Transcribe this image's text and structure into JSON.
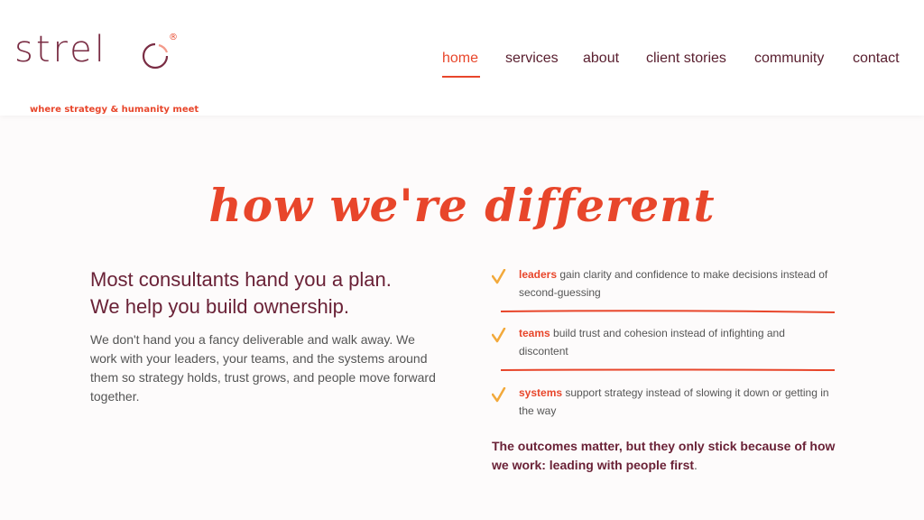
{
  "brand": {
    "logo_text": "strel",
    "registered": "®",
    "tagline": "where strategy & humanity meet"
  },
  "nav": {
    "items": [
      {
        "label": "home",
        "active": true
      },
      {
        "label": "services"
      },
      {
        "label": "about"
      },
      {
        "label": "client stories"
      },
      {
        "label": "community"
      },
      {
        "label": "contact"
      }
    ]
  },
  "section": {
    "title": "how we're different",
    "headline_line1": "Most consultants hand you a plan.",
    "headline_line2": "We help you build ownership.",
    "body": "We don't hand you a fancy deliverable and walk away. We work with your leaders, your teams, and the systems around them so strategy holds, trust grows, and people move forward together.",
    "points": [
      {
        "keyword": "leaders",
        "text": " gain clarity and confidence to make decisions instead of second-guessing"
      },
      {
        "keyword": "teams",
        "text": " build trust and cohesion instead of infighting and discontent"
      },
      {
        "keyword": "systems",
        "text": " support strategy instead of slowing it down or getting in the way"
      }
    ],
    "outcome": "The outcomes matter, but they only stick because of how we work: leading with people first",
    "outcome_end": "."
  },
  "colors": {
    "accent": "#e8462b",
    "brand": "#7a2d44",
    "check": "#f2a93b"
  }
}
